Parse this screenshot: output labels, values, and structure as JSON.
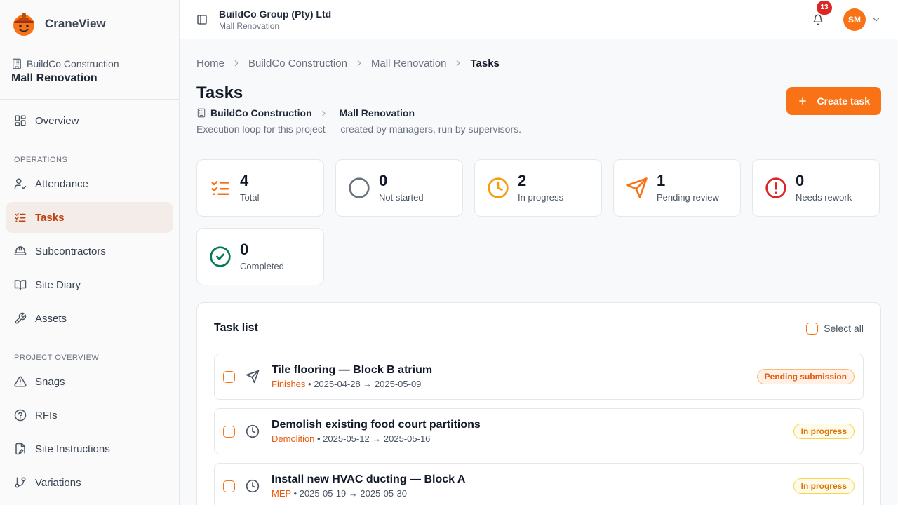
{
  "brand": {
    "name": "CraneView"
  },
  "project": {
    "org": "BuildCo Construction",
    "name": "Mall Renovation"
  },
  "sidebar": {
    "overview": "Overview",
    "operations_label": "OPERATIONS",
    "operations": [
      {
        "label": "Attendance",
        "icon": "user-check-icon"
      },
      {
        "label": "Tasks",
        "icon": "list-checks-icon",
        "active": true
      },
      {
        "label": "Subcontractors",
        "icon": "hard-hat-icon"
      },
      {
        "label": "Site Diary",
        "icon": "book-icon"
      },
      {
        "label": "Assets",
        "icon": "wrench-icon"
      }
    ],
    "overview_label": "PROJECT OVERVIEW",
    "project_items": [
      {
        "label": "Snags",
        "icon": "warning-icon"
      },
      {
        "label": "RFIs",
        "icon": "help-circle-icon"
      },
      {
        "label": "Site Instructions",
        "icon": "file-signature-icon"
      },
      {
        "label": "Variations",
        "icon": "git-branch-icon"
      }
    ]
  },
  "topbar": {
    "company": "BuildCo Group (Pty) Ltd",
    "project": "Mall Renovation",
    "notifications": "13",
    "avatar": "SM"
  },
  "breadcrumb": {
    "items": [
      "Home",
      "BuildCo Construction",
      "Mall Renovation"
    ],
    "current": "Tasks"
  },
  "page": {
    "title": "Tasks",
    "org": "BuildCo Construction",
    "project": "Mall Renovation",
    "description": "Execution loop for this project — created by managers, run by supervisors.",
    "create_label": "Create task"
  },
  "stats": [
    {
      "value": "4",
      "label": "Total",
      "icon": "list-checks-icon",
      "color": "#f97316"
    },
    {
      "value": "0",
      "label": "Not started",
      "icon": "circle-icon",
      "color": "#6b7280"
    },
    {
      "value": "2",
      "label": "In progress",
      "icon": "clock-icon",
      "color": "#f59e0b"
    },
    {
      "value": "1",
      "label": "Pending review",
      "icon": "send-icon",
      "color": "#f97316"
    },
    {
      "value": "0",
      "label": "Needs rework",
      "icon": "alert-circle-icon",
      "color": "#dc2626"
    },
    {
      "value": "0",
      "label": "Completed",
      "icon": "check-circle-icon",
      "color": "#047857"
    }
  ],
  "task_list": {
    "title": "Task list",
    "select_all": "Select all",
    "tasks": [
      {
        "title": "Tile flooring — Block B atrium",
        "trade": "Finishes",
        "dates": " • 2025-04-28 → 2025-05-09",
        "status": "Pending submission",
        "icon": "send-icon"
      },
      {
        "title": "Demolish existing food court partitions",
        "trade": "Demolition",
        "dates": " • 2025-05-12 → 2025-05-16",
        "status": "In progress",
        "icon": "clock-icon"
      },
      {
        "title": "Install new HVAC ducting — Block A",
        "trade": "MEP",
        "dates": " • 2025-05-19 → 2025-05-30",
        "status": "In progress",
        "icon": "clock-icon"
      }
    ]
  }
}
